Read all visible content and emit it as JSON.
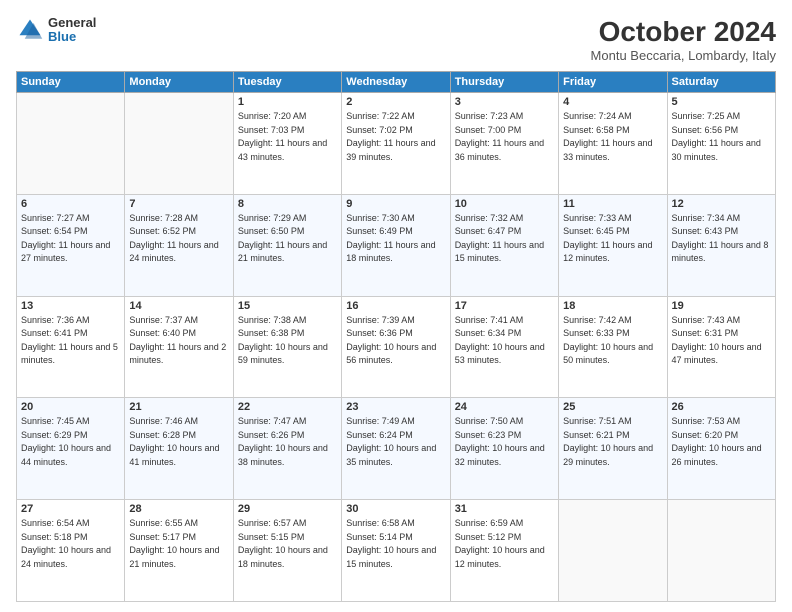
{
  "logo": {
    "general": "General",
    "blue": "Blue"
  },
  "header": {
    "month": "October 2024",
    "location": "Montu Beccaria, Lombardy, Italy"
  },
  "weekdays": [
    "Sunday",
    "Monday",
    "Tuesday",
    "Wednesday",
    "Thursday",
    "Friday",
    "Saturday"
  ],
  "weeks": [
    [
      {
        "day": "",
        "info": ""
      },
      {
        "day": "",
        "info": ""
      },
      {
        "day": "1",
        "info": "Sunrise: 7:20 AM\nSunset: 7:03 PM\nDaylight: 11 hours and 43 minutes."
      },
      {
        "day": "2",
        "info": "Sunrise: 7:22 AM\nSunset: 7:02 PM\nDaylight: 11 hours and 39 minutes."
      },
      {
        "day": "3",
        "info": "Sunrise: 7:23 AM\nSunset: 7:00 PM\nDaylight: 11 hours and 36 minutes."
      },
      {
        "day": "4",
        "info": "Sunrise: 7:24 AM\nSunset: 6:58 PM\nDaylight: 11 hours and 33 minutes."
      },
      {
        "day": "5",
        "info": "Sunrise: 7:25 AM\nSunset: 6:56 PM\nDaylight: 11 hours and 30 minutes."
      }
    ],
    [
      {
        "day": "6",
        "info": "Sunrise: 7:27 AM\nSunset: 6:54 PM\nDaylight: 11 hours and 27 minutes."
      },
      {
        "day": "7",
        "info": "Sunrise: 7:28 AM\nSunset: 6:52 PM\nDaylight: 11 hours and 24 minutes."
      },
      {
        "day": "8",
        "info": "Sunrise: 7:29 AM\nSunset: 6:50 PM\nDaylight: 11 hours and 21 minutes."
      },
      {
        "day": "9",
        "info": "Sunrise: 7:30 AM\nSunset: 6:49 PM\nDaylight: 11 hours and 18 minutes."
      },
      {
        "day": "10",
        "info": "Sunrise: 7:32 AM\nSunset: 6:47 PM\nDaylight: 11 hours and 15 minutes."
      },
      {
        "day": "11",
        "info": "Sunrise: 7:33 AM\nSunset: 6:45 PM\nDaylight: 11 hours and 12 minutes."
      },
      {
        "day": "12",
        "info": "Sunrise: 7:34 AM\nSunset: 6:43 PM\nDaylight: 11 hours and 8 minutes."
      }
    ],
    [
      {
        "day": "13",
        "info": "Sunrise: 7:36 AM\nSunset: 6:41 PM\nDaylight: 11 hours and 5 minutes."
      },
      {
        "day": "14",
        "info": "Sunrise: 7:37 AM\nSunset: 6:40 PM\nDaylight: 11 hours and 2 minutes."
      },
      {
        "day": "15",
        "info": "Sunrise: 7:38 AM\nSunset: 6:38 PM\nDaylight: 10 hours and 59 minutes."
      },
      {
        "day": "16",
        "info": "Sunrise: 7:39 AM\nSunset: 6:36 PM\nDaylight: 10 hours and 56 minutes."
      },
      {
        "day": "17",
        "info": "Sunrise: 7:41 AM\nSunset: 6:34 PM\nDaylight: 10 hours and 53 minutes."
      },
      {
        "day": "18",
        "info": "Sunrise: 7:42 AM\nSunset: 6:33 PM\nDaylight: 10 hours and 50 minutes."
      },
      {
        "day": "19",
        "info": "Sunrise: 7:43 AM\nSunset: 6:31 PM\nDaylight: 10 hours and 47 minutes."
      }
    ],
    [
      {
        "day": "20",
        "info": "Sunrise: 7:45 AM\nSunset: 6:29 PM\nDaylight: 10 hours and 44 minutes."
      },
      {
        "day": "21",
        "info": "Sunrise: 7:46 AM\nSunset: 6:28 PM\nDaylight: 10 hours and 41 minutes."
      },
      {
        "day": "22",
        "info": "Sunrise: 7:47 AM\nSunset: 6:26 PM\nDaylight: 10 hours and 38 minutes."
      },
      {
        "day": "23",
        "info": "Sunrise: 7:49 AM\nSunset: 6:24 PM\nDaylight: 10 hours and 35 minutes."
      },
      {
        "day": "24",
        "info": "Sunrise: 7:50 AM\nSunset: 6:23 PM\nDaylight: 10 hours and 32 minutes."
      },
      {
        "day": "25",
        "info": "Sunrise: 7:51 AM\nSunset: 6:21 PM\nDaylight: 10 hours and 29 minutes."
      },
      {
        "day": "26",
        "info": "Sunrise: 7:53 AM\nSunset: 6:20 PM\nDaylight: 10 hours and 26 minutes."
      }
    ],
    [
      {
        "day": "27",
        "info": "Sunrise: 6:54 AM\nSunset: 5:18 PM\nDaylight: 10 hours and 24 minutes."
      },
      {
        "day": "28",
        "info": "Sunrise: 6:55 AM\nSunset: 5:17 PM\nDaylight: 10 hours and 21 minutes."
      },
      {
        "day": "29",
        "info": "Sunrise: 6:57 AM\nSunset: 5:15 PM\nDaylight: 10 hours and 18 minutes."
      },
      {
        "day": "30",
        "info": "Sunrise: 6:58 AM\nSunset: 5:14 PM\nDaylight: 10 hours and 15 minutes."
      },
      {
        "day": "31",
        "info": "Sunrise: 6:59 AM\nSunset: 5:12 PM\nDaylight: 10 hours and 12 minutes."
      },
      {
        "day": "",
        "info": ""
      },
      {
        "day": "",
        "info": ""
      }
    ]
  ]
}
